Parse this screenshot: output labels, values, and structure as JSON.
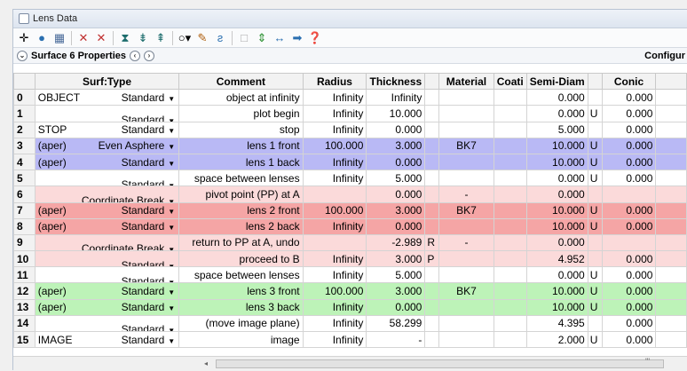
{
  "window": {
    "title": "Lens Data"
  },
  "toolbar": {
    "icons": [
      "move-icon",
      "globe-icon",
      "chart-icon",
      "solve-icon-1",
      "solve-icon-2",
      "lens-icon-1",
      "lens-icon-2",
      "lens-icon-3",
      "circle-dropdown-icon",
      "pencil-icon",
      "wave-icon",
      "blank-icon",
      "updown-icon",
      "arrows-icon",
      "right-arrow-icon",
      "help-icon"
    ]
  },
  "properties": {
    "label": "Surface 6 Properties",
    "config_label": "Configur"
  },
  "columns": [
    "",
    "Surf:Type",
    "Comment",
    "Radius",
    "Thickness",
    "",
    "Material",
    "Coati",
    "Semi-Diam",
    "",
    "Conic"
  ],
  "rows": [
    {
      "n": "0",
      "name": "OBJECT",
      "type": "Standard",
      "comment": "object at infinity",
      "radius": "Infinity",
      "thick": "Infinity",
      "tflag": "",
      "mat": "",
      "semi": "0.000",
      "sflag": "",
      "conic": "0.000",
      "style": ""
    },
    {
      "n": "1",
      "name": "",
      "type": "Standard",
      "comment": "plot begin",
      "radius": "Infinity",
      "thick": "10.000",
      "tflag": "",
      "mat": "",
      "semi": "0.000",
      "sflag": "U",
      "conic": "0.000",
      "style": ""
    },
    {
      "n": "2",
      "name": "STOP",
      "type": "Standard",
      "comment": "stop",
      "radius": "Infinity",
      "thick": "0.000",
      "tflag": "",
      "mat": "",
      "semi": "5.000",
      "sflag": "",
      "conic": "0.000",
      "style": ""
    },
    {
      "n": "3",
      "name": "(aper)",
      "type": "Even Asphere",
      "comment": "lens 1 front",
      "radius": "100.000",
      "thick": "3.000",
      "tflag": "",
      "mat": "BK7",
      "semi": "10.000",
      "sflag": "U",
      "conic": "0.000",
      "style": "blue"
    },
    {
      "n": "4",
      "name": "(aper)",
      "type": "Standard",
      "comment": "lens 1 back",
      "radius": "Infinity",
      "thick": "0.000",
      "tflag": "",
      "mat": "",
      "semi": "10.000",
      "sflag": "U",
      "conic": "0.000",
      "style": "blue"
    },
    {
      "n": "5",
      "name": "",
      "type": "Standard",
      "comment": "space between lenses",
      "radius": "Infinity",
      "thick": "5.000",
      "tflag": "",
      "mat": "",
      "semi": "0.000",
      "sflag": "U",
      "conic": "0.000",
      "style": ""
    },
    {
      "n": "6",
      "name": "",
      "type": "Coordinate Break",
      "comment": "pivot point (PP) at A",
      "radius": "",
      "thick": "0.000",
      "tflag": "",
      "mat": "-",
      "semi": "0.000",
      "sflag": "",
      "conic": "",
      "style": "pink"
    },
    {
      "n": "7",
      "name": "(aper)",
      "type": "Standard",
      "comment": "lens 2 front",
      "radius": "100.000",
      "thick": "3.000",
      "tflag": "",
      "mat": "BK7",
      "semi": "10.000",
      "sflag": "U",
      "conic": "0.000",
      "style": "red"
    },
    {
      "n": "8",
      "name": "(aper)",
      "type": "Standard",
      "comment": "lens 2 back",
      "radius": "Infinity",
      "thick": "0.000",
      "tflag": "",
      "mat": "",
      "semi": "10.000",
      "sflag": "U",
      "conic": "0.000",
      "style": "red"
    },
    {
      "n": "9",
      "name": "",
      "type": "Coordinate Break",
      "comment": "return to PP at A, undo",
      "radius": "",
      "thick": "-2.989",
      "tflag": "R",
      "mat": "-",
      "semi": "0.000",
      "sflag": "",
      "conic": "",
      "style": "pink"
    },
    {
      "n": "10",
      "name": "",
      "type": "Standard",
      "comment": "proceed to B",
      "radius": "Infinity",
      "thick": "3.000",
      "tflag": "P",
      "mat": "",
      "semi": "4.952",
      "sflag": "",
      "conic": "0.000",
      "style": "pink"
    },
    {
      "n": "11",
      "name": "",
      "type": "Standard",
      "comment": "space between lenses",
      "radius": "Infinity",
      "thick": "5.000",
      "tflag": "",
      "mat": "",
      "semi": "0.000",
      "sflag": "U",
      "conic": "0.000",
      "style": ""
    },
    {
      "n": "12",
      "name": "(aper)",
      "type": "Standard",
      "comment": "lens 3 front",
      "radius": "100.000",
      "thick": "3.000",
      "tflag": "",
      "mat": "BK7",
      "semi": "10.000",
      "sflag": "U",
      "conic": "0.000",
      "style": "green"
    },
    {
      "n": "13",
      "name": "(aper)",
      "type": "Standard",
      "comment": "lens 3 back",
      "radius": "Infinity",
      "thick": "0.000",
      "tflag": "",
      "mat": "",
      "semi": "10.000",
      "sflag": "U",
      "conic": "0.000",
      "style": "green"
    },
    {
      "n": "14",
      "name": "",
      "type": "Standard",
      "comment": "(move image plane)",
      "radius": "Infinity",
      "thick": "58.299",
      "tflag": "",
      "mat": "",
      "semi": "4.395",
      "sflag": "",
      "conic": "0.000",
      "style": ""
    },
    {
      "n": "15",
      "name": "IMAGE",
      "type": "Standard",
      "comment": "image",
      "radius": "Infinity",
      "thick": "-",
      "tflag": "",
      "mat": "",
      "semi": "2.000",
      "sflag": "U",
      "conic": "0.000",
      "style": ""
    }
  ]
}
